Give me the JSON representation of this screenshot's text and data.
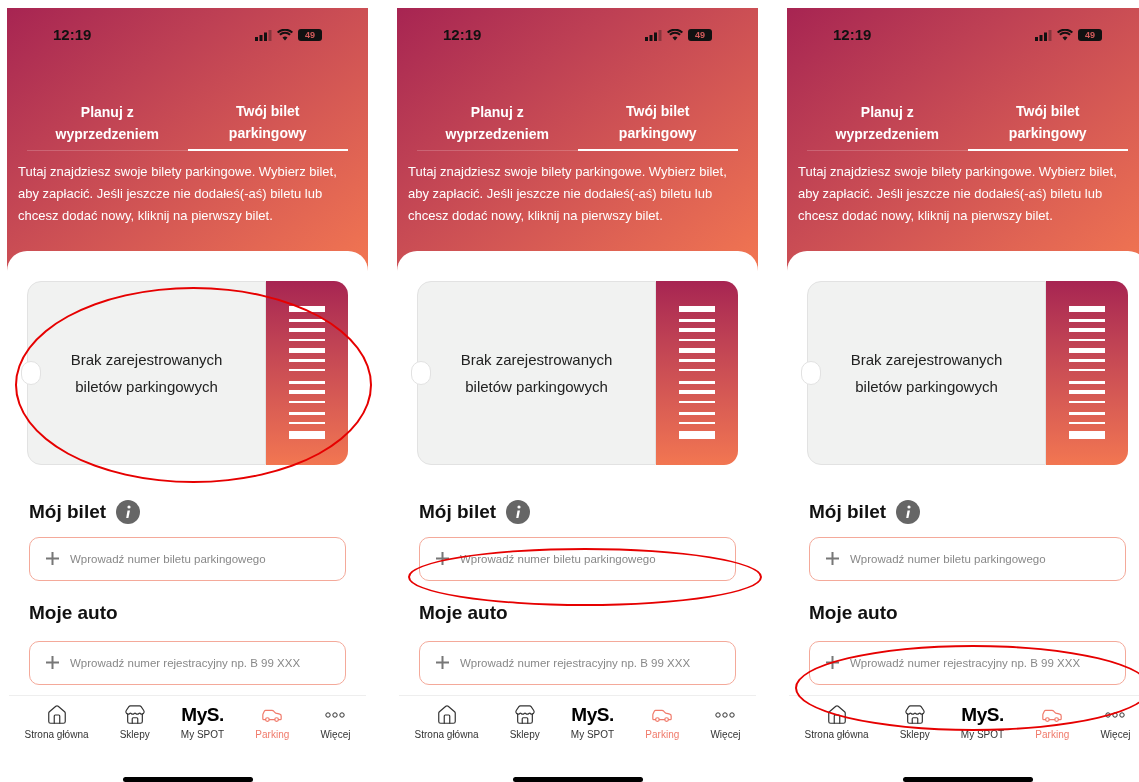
{
  "phones": [
    {
      "highlight": {
        "kind": "ticket"
      },
      "status_bar": {
        "time": "12:19",
        "battery": "49"
      },
      "tabs": [
        {
          "label": "Planuj z wyprzedzeniem",
          "selected": false
        },
        {
          "label": "Twój bilet parkingowy",
          "selected": true
        }
      ],
      "description": "Tutaj znajdziesz swoje bilety parkingowe. Wybierz bilet, aby zapłacić. Jeśli jeszcze nie dodałeś(-aś) biletu lub chcesz dodać nowy, kliknij na pierwszy bilet.",
      "ticket": {
        "text": "Brak zarejestrowanych biletów parkingowych"
      },
      "ticket_section": {
        "title": "Mój bilet",
        "placeholder": "Wprowadź numer biletu parkingowego"
      },
      "car_section": {
        "title": "Moje auto",
        "placeholder": "Wprowadź numer rejestracyjny np. B 99 XXX"
      },
      "nav": [
        {
          "kind": "home",
          "label": "Strona główna",
          "selected": false
        },
        {
          "kind": "store",
          "label": "Sklepy",
          "selected": false
        },
        {
          "kind": "logo",
          "logo": "MyS.",
          "label": "My SPOT",
          "selected": false
        },
        {
          "kind": "car",
          "label": "Parking",
          "selected": true
        },
        {
          "kind": "more",
          "label": "Więcej",
          "selected": false
        }
      ]
    },
    {
      "highlight": {
        "kind": "ticket_field"
      },
      "status_bar": {
        "time": "12:19",
        "battery": "49"
      },
      "tabs": [
        {
          "label": "Planuj z wyprzedzeniem",
          "selected": false
        },
        {
          "label": "Twój bilet parkingowy",
          "selected": true
        }
      ],
      "description": "Tutaj znajdziesz swoje bilety parkingowe. Wybierz bilet, aby zapłacić. Jeśli jeszcze nie dodałeś(-aś) biletu lub chcesz dodać nowy, kliknij na pierwszy bilet.",
      "ticket": {
        "text": "Brak zarejestrowanych biletów parkingowych"
      },
      "ticket_section": {
        "title": "Mój bilet",
        "placeholder": "Wprowadź numer biletu parkingowego"
      },
      "car_section": {
        "title": "Moje auto",
        "placeholder": "Wprowadź numer rejestracyjny np. B 99 XXX"
      },
      "nav": [
        {
          "kind": "home",
          "label": "Strona główna",
          "selected": false
        },
        {
          "kind": "store",
          "label": "Sklepy",
          "selected": false
        },
        {
          "kind": "logo",
          "logo": "MyS.",
          "label": "My SPOT",
          "selected": false
        },
        {
          "kind": "car",
          "label": "Parking",
          "selected": true
        },
        {
          "kind": "more",
          "label": "Więcej",
          "selected": false
        }
      ]
    },
    {
      "highlight": {
        "kind": "car_field"
      },
      "status_bar": {
        "time": "12:19",
        "battery": "49"
      },
      "tabs": [
        {
          "label": "Planuj z wyprzedzeniem",
          "selected": false
        },
        {
          "label": "Twój bilet parkingowy",
          "selected": true
        }
      ],
      "description": "Tutaj znajdziesz swoje bilety parkingowe. Wybierz bilet, aby zapłacić. Jeśli jeszcze nie dodałeś(-aś) biletu lub chcesz dodać nowy, kliknij na pierwszy bilet.",
      "ticket": {
        "text": "Brak zarejestrowanych biletów parkingowych"
      },
      "ticket_section": {
        "title": "Mój bilet",
        "placeholder": "Wprowadź numer biletu parkingowego"
      },
      "car_section": {
        "title": "Moje auto",
        "placeholder": "Wprowadź numer rejestracyjny np. B 99 XXX"
      },
      "nav": [
        {
          "kind": "home",
          "label": "Strona główna",
          "selected": false
        },
        {
          "kind": "store",
          "label": "Sklepy",
          "selected": false
        },
        {
          "kind": "logo",
          "logo": "MyS.",
          "label": "My SPOT",
          "selected": false
        },
        {
          "kind": "car",
          "label": "Parking",
          "selected": true
        },
        {
          "kind": "more",
          "label": "Więcej",
          "selected": false
        }
      ]
    }
  ]
}
